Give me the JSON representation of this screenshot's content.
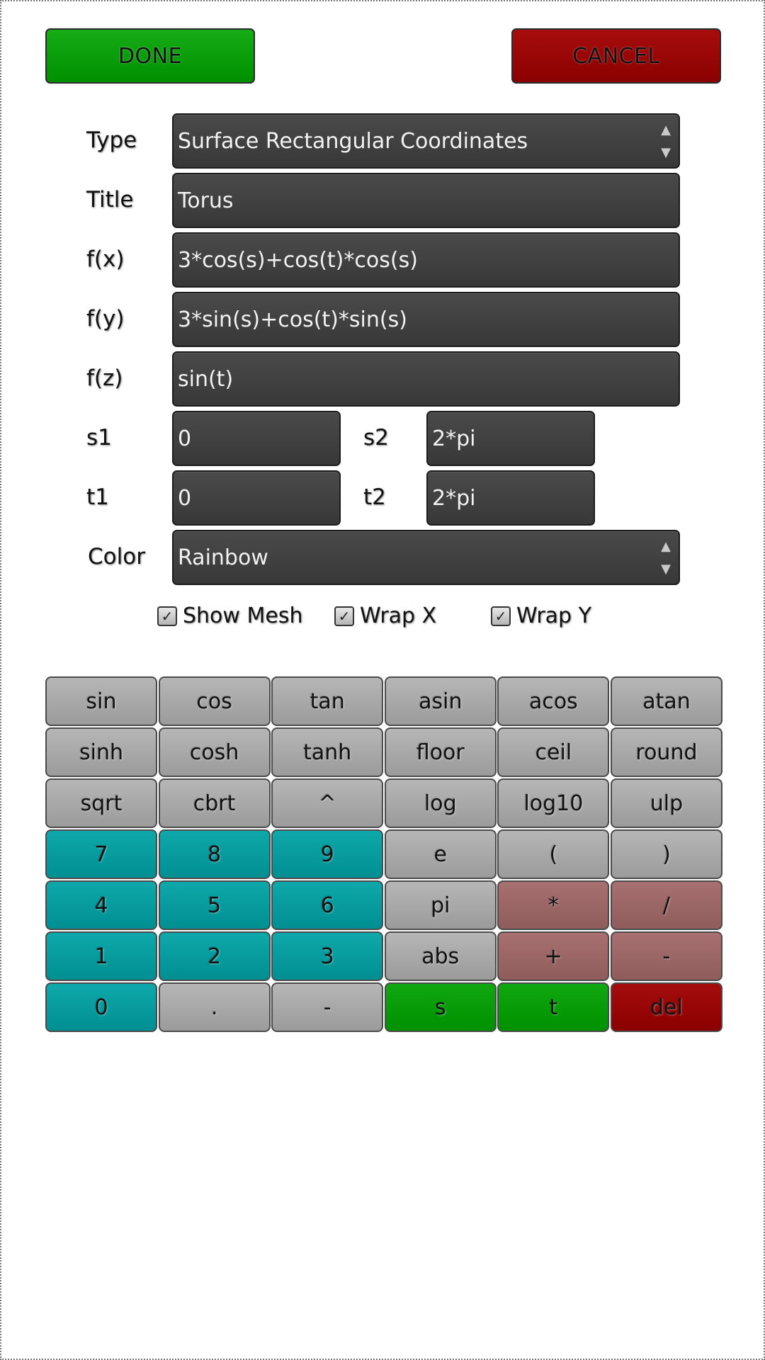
{
  "buttons": {
    "done": "DONE",
    "cancel": "CANCEL"
  },
  "form": {
    "type": {
      "label": "Type",
      "value": "Surface Rectangular Coordinates"
    },
    "title": {
      "label": "Title",
      "value": "Torus"
    },
    "fx": {
      "label": "f(x)",
      "value": "3*cos(s)+cos(t)*cos(s)"
    },
    "fy": {
      "label": "f(y)",
      "value": "3*sin(s)+cos(t)*sin(s)"
    },
    "fz": {
      "label": "f(z)",
      "value": "sin(t)"
    },
    "s1": {
      "label": "s1",
      "value": "0"
    },
    "s2": {
      "label": "s2",
      "value": "2*pi"
    },
    "t1": {
      "label": "t1",
      "value": "0"
    },
    "t2": {
      "label": "t2",
      "value": "2*pi"
    },
    "color": {
      "label": "Color",
      "value": "Rainbow"
    }
  },
  "checkboxes": {
    "show_mesh": {
      "label": "Show Mesh",
      "checked": true
    },
    "wrap_x": {
      "label": "Wrap X",
      "checked": true
    },
    "wrap_y": {
      "label": "Wrap Y",
      "checked": true
    }
  },
  "check_glyph": "✓",
  "spinner": {
    "up": "▲",
    "down": "▼"
  },
  "keypad": {
    "rows": [
      [
        "sin",
        "cos",
        "tan",
        "asin",
        "acos",
        "atan"
      ],
      [
        "sinh",
        "cosh",
        "tanh",
        "floor",
        "ceil",
        "round"
      ],
      [
        "sqrt",
        "cbrt",
        "^",
        "log",
        "log10",
        "ulp"
      ],
      [
        "7",
        "8",
        "9",
        "e",
        "(",
        ")"
      ],
      [
        "4",
        "5",
        "6",
        "pi",
        "*",
        "/"
      ],
      [
        "1",
        "2",
        "3",
        "abs",
        "+",
        "-"
      ],
      [
        "0",
        ".",
        "-",
        "s",
        "t",
        "del"
      ]
    ]
  },
  "colors": {
    "done_green": "#009900",
    "cancel_red": "#8b0000",
    "field_dark": "#3f3f3f",
    "key_gray": "#a6a6a6",
    "key_teal": "#009b9e",
    "key_rose": "#996666",
    "key_green": "#009900",
    "key_red": "#8b0000"
  }
}
